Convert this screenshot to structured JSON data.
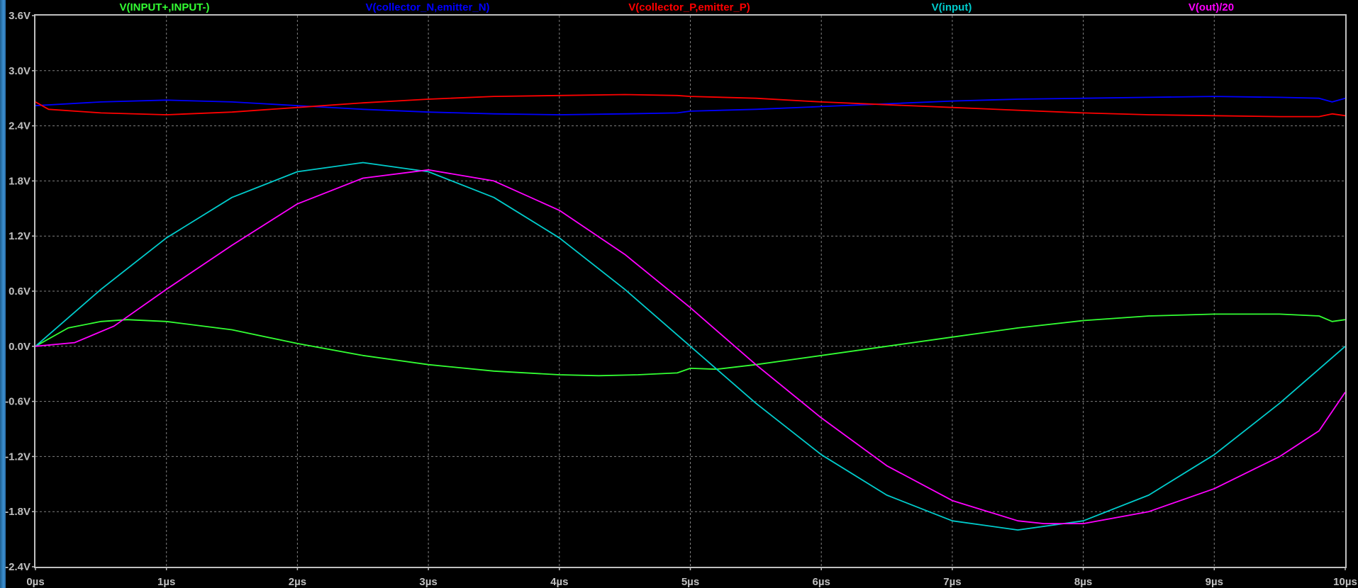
{
  "chart_data": {
    "type": "line",
    "title": "",
    "xlabel": "",
    "ylabel": "",
    "xlim": [
      0,
      10
    ],
    "ylim": [
      -2.4,
      3.6
    ],
    "grid": true,
    "legend_placement": "top",
    "x_ticks": [
      {
        "value": 0,
        "label": "0µs"
      },
      {
        "value": 1,
        "label": "1µs"
      },
      {
        "value": 2,
        "label": "2µs"
      },
      {
        "value": 3,
        "label": "3µs"
      },
      {
        "value": 4,
        "label": "4µs"
      },
      {
        "value": 5,
        "label": "5µs"
      },
      {
        "value": 6,
        "label": "6µs"
      },
      {
        "value": 7,
        "label": "7µs"
      },
      {
        "value": 8,
        "label": "8µs"
      },
      {
        "value": 9,
        "label": "9µs"
      },
      {
        "value": 10,
        "label": "10µs"
      }
    ],
    "y_ticks": [
      {
        "value": 3.6,
        "label": "3.6V"
      },
      {
        "value": 3.0,
        "label": "3.0V"
      },
      {
        "value": 2.4,
        "label": "2.4V"
      },
      {
        "value": 1.8,
        "label": "1.8V"
      },
      {
        "value": 1.2,
        "label": "1.2V"
      },
      {
        "value": 0.6,
        "label": "0.6V"
      },
      {
        "value": 0.0,
        "label": "0.0V"
      },
      {
        "value": -0.6,
        "label": "-0.6V"
      },
      {
        "value": -1.2,
        "label": "-1.2V"
      },
      {
        "value": -1.8,
        "label": "-1.8V"
      },
      {
        "value": -2.4,
        "label": "-2.4V"
      }
    ],
    "series": [
      {
        "name": "V(INPUT+,INPUT-)",
        "color": "#33ff33",
        "x": [
          0,
          0.25,
          0.5,
          0.7,
          1.0,
          1.5,
          2.0,
          2.5,
          3.0,
          3.5,
          4.0,
          4.3,
          4.6,
          4.9,
          5.0,
          5.2,
          5.5,
          6.0,
          6.5,
          7.0,
          7.5,
          8.0,
          8.5,
          9.0,
          9.5,
          9.8,
          9.9,
          10.0
        ],
        "y": [
          0.0,
          0.2,
          0.27,
          0.29,
          0.27,
          0.18,
          0.03,
          -0.1,
          -0.2,
          -0.27,
          -0.31,
          -0.32,
          -0.31,
          -0.29,
          -0.24,
          -0.25,
          -0.2,
          -0.1,
          0.0,
          0.1,
          0.2,
          0.28,
          0.33,
          0.35,
          0.35,
          0.33,
          0.27,
          0.29
        ]
      },
      {
        "name": "V(collector_N,emitter_N)",
        "color": "#0000ff",
        "x": [
          0,
          0.5,
          1.0,
          1.5,
          2.0,
          2.5,
          3.0,
          3.5,
          4.0,
          4.5,
          4.9,
          5.0,
          5.5,
          6.0,
          6.5,
          7.0,
          7.5,
          8.0,
          8.5,
          9.0,
          9.5,
          9.8,
          9.9,
          10.0
        ],
        "y": [
          2.62,
          2.66,
          2.68,
          2.66,
          2.62,
          2.58,
          2.55,
          2.53,
          2.52,
          2.53,
          2.54,
          2.56,
          2.58,
          2.61,
          2.64,
          2.67,
          2.69,
          2.7,
          2.71,
          2.72,
          2.71,
          2.7,
          2.66,
          2.7
        ]
      },
      {
        "name": "V(collector_P,emitter_P)",
        "color": "#ff0000",
        "x": [
          0,
          0.1,
          0.5,
          1.0,
          1.5,
          2.0,
          2.5,
          3.0,
          3.5,
          4.0,
          4.5,
          4.9,
          5.0,
          5.5,
          6.0,
          6.5,
          7.0,
          7.5,
          8.0,
          8.5,
          9.0,
          9.5,
          9.8,
          9.9,
          10.0
        ],
        "y": [
          2.66,
          2.58,
          2.54,
          2.52,
          2.55,
          2.6,
          2.65,
          2.69,
          2.72,
          2.73,
          2.74,
          2.73,
          2.72,
          2.7,
          2.66,
          2.63,
          2.6,
          2.57,
          2.54,
          2.52,
          2.51,
          2.5,
          2.5,
          2.53,
          2.51
        ]
      },
      {
        "name": "V(input)",
        "color": "#00cccc",
        "x": [
          0,
          0.5,
          1.0,
          1.5,
          2.0,
          2.5,
          3.0,
          3.5,
          4.0,
          4.5,
          5.0,
          5.5,
          6.0,
          6.5,
          7.0,
          7.5,
          8.0,
          8.5,
          9.0,
          9.5,
          10.0
        ],
        "y": [
          0.0,
          0.62,
          1.18,
          1.62,
          1.9,
          2.0,
          1.9,
          1.62,
          1.18,
          0.62,
          0.0,
          -0.62,
          -1.18,
          -1.62,
          -1.9,
          -2.0,
          -1.9,
          -1.62,
          -1.18,
          -0.62,
          0.0
        ]
      },
      {
        "name": "V(out)/20",
        "color": "#ff00ff",
        "x": [
          0,
          0.3,
          0.6,
          1.0,
          1.5,
          2.0,
          2.5,
          3.0,
          3.5,
          4.0,
          4.5,
          5.0,
          5.5,
          6.0,
          6.5,
          7.0,
          7.5,
          7.7,
          8.0,
          8.5,
          9.0,
          9.5,
          9.8,
          10.0
        ],
        "y": [
          0.0,
          0.04,
          0.22,
          0.62,
          1.1,
          1.55,
          1.83,
          1.92,
          1.8,
          1.48,
          1.0,
          0.42,
          -0.2,
          -0.78,
          -1.3,
          -1.68,
          -1.9,
          -1.93,
          -1.93,
          -1.8,
          -1.55,
          -1.2,
          -0.92,
          -0.5
        ]
      }
    ]
  }
}
